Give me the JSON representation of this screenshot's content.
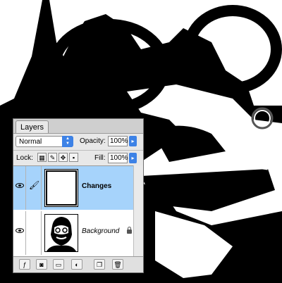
{
  "panel": {
    "tab_label": "Layers",
    "blend_mode": "Normal",
    "opacity_label": "Opacity:",
    "opacity_value": "100%",
    "lock_label": "Lock:",
    "fill_label": "Fill:",
    "fill_value": "100%"
  },
  "layers": [
    {
      "name": "Changes",
      "selected": true,
      "visible": true
    },
    {
      "name": "Background",
      "selected": false,
      "visible": true,
      "locked": true
    }
  ],
  "colors": {
    "selection": "#a6d3fb",
    "accent": "#3d82e6"
  },
  "icons": {
    "lock_buttons": [
      "lock-transparent-icon",
      "lock-paint-icon",
      "lock-move-icon",
      "lock-all-icon"
    ],
    "bottom_buttons": [
      "layer-style-icon",
      "layer-mask-icon",
      "new-group-icon",
      "adjustment-layer-icon",
      "new-layer-icon",
      "trash-icon"
    ]
  }
}
